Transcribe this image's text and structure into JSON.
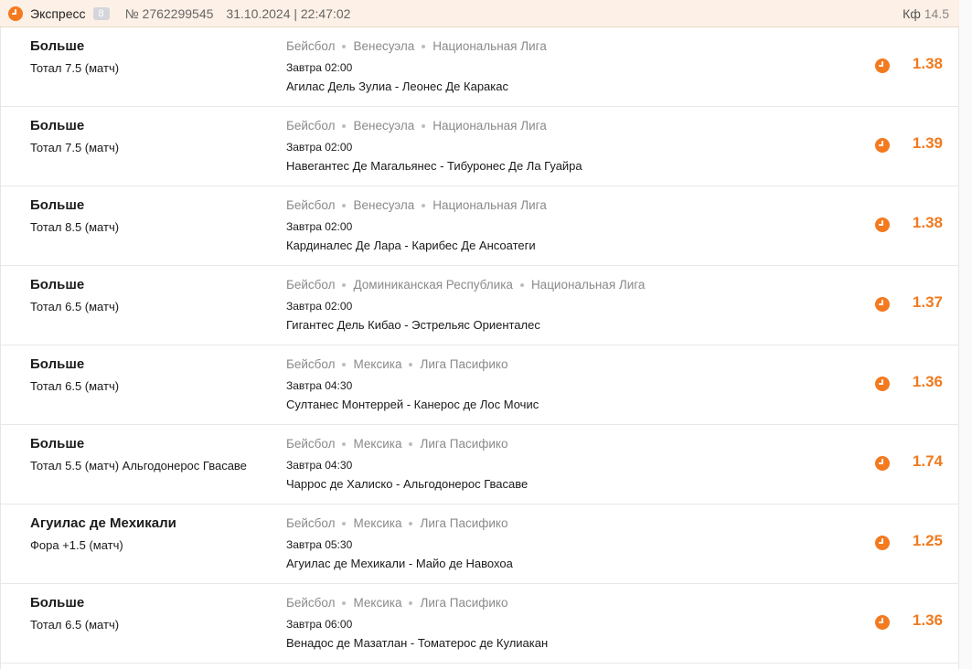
{
  "header": {
    "title": "Экспресс",
    "count": "8",
    "number": "№ 2762299545",
    "date": "31.10.2024 | 22:47:02",
    "coef_label": "Кф",
    "coef_value": "14.5"
  },
  "colors": {
    "accent": "#f07a1f",
    "header_bg": "#fdf0e6",
    "muted": "#8a8a8a"
  },
  "bets": [
    {
      "outcome": "Больше",
      "market": "Тотал 7.5 (матч)",
      "crumbs": [
        "Бейсбол",
        "Венесуэла",
        "Национальная Лига"
      ],
      "when": "Завтра 02:00",
      "teams": "Агилас Дель Зулиа - Леонес Де Каракас",
      "odd": "1.38"
    },
    {
      "outcome": "Больше",
      "market": "Тотал 7.5 (матч)",
      "crumbs": [
        "Бейсбол",
        "Венесуэла",
        "Национальная Лига"
      ],
      "when": "Завтра 02:00",
      "teams": "Навегантес Де Магальянес - Тибуронес Де Ла Гуайра",
      "odd": "1.39"
    },
    {
      "outcome": "Больше",
      "market": "Тотал 8.5 (матч)",
      "crumbs": [
        "Бейсбол",
        "Венесуэла",
        "Национальная Лига"
      ],
      "when": "Завтра 02:00",
      "teams": "Кардиналес Де Лара - Карибес Де Ансоатеги",
      "odd": "1.38"
    },
    {
      "outcome": "Больше",
      "market": "Тотал 6.5 (матч)",
      "crumbs": [
        "Бейсбол",
        "Доминиканская Республика",
        "Национальная Лига"
      ],
      "when": "Завтра 02:00",
      "teams": "Гигантес Дель Кибао - Эстрельяс Ориенталес",
      "odd": "1.37"
    },
    {
      "outcome": "Больше",
      "market": "Тотал 6.5 (матч)",
      "crumbs": [
        "Бейсбол",
        "Мексика",
        "Лига Пасифико"
      ],
      "when": "Завтра 04:30",
      "teams": "Султанес Монтеррей - Канерос де Лос Мочис",
      "odd": "1.36"
    },
    {
      "outcome": "Больше",
      "market": "Тотал 5.5 (матч) Альгодонерос Гвасаве",
      "crumbs": [
        "Бейсбол",
        "Мексика",
        "Лига Пасифико"
      ],
      "when": "Завтра 04:30",
      "teams": "Чаррос де Халиско - Альгодонерос Гвасаве",
      "odd": "1.74"
    },
    {
      "outcome": "Агуилас де Мехикали",
      "market": "Фора +1.5 (матч)",
      "crumbs": [
        "Бейсбол",
        "Мексика",
        "Лига Пасифико"
      ],
      "when": "Завтра 05:30",
      "teams": "Агуилас де Мехикали - Майо де Навохоа",
      "odd": "1.25"
    },
    {
      "outcome": "Больше",
      "market": "Тотал 6.5 (матч)",
      "crumbs": [
        "Бейсбол",
        "Мексика",
        "Лига Пасифико"
      ],
      "when": "Завтра 06:00",
      "teams": "Венадос де Мазатлан - Томатерос де Кулиакан",
      "odd": "1.36"
    }
  ]
}
